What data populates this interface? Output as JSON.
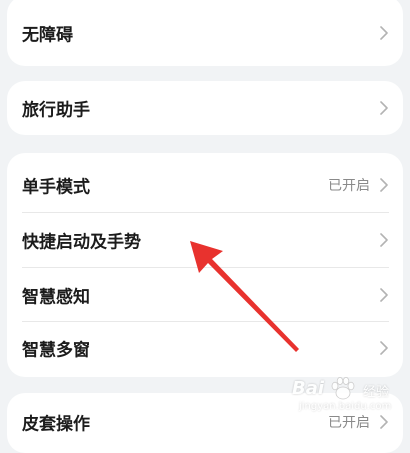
{
  "settings": {
    "group1": {
      "items": [
        {
          "label": "无障碍"
        }
      ]
    },
    "group2": {
      "items": [
        {
          "label": "旅行助手"
        }
      ]
    },
    "group3": {
      "items": [
        {
          "label": "单手模式",
          "value": "已开启"
        },
        {
          "label": "快捷启动及手势"
        },
        {
          "label": "智慧感知"
        },
        {
          "label": "智慧多窗"
        }
      ]
    },
    "group4": {
      "items": [
        {
          "label": "皮套操作",
          "value": "已开启"
        }
      ]
    }
  },
  "colors": {
    "background": "#f1f3f5",
    "card": "#ffffff",
    "label": "#1c1c1c",
    "value": "#8a8a8a",
    "chevron": "#b3b3b3",
    "annotation_arrow": "#e8322e"
  },
  "icons": {
    "row_chevron": "chevron-right-icon"
  },
  "watermark": {
    "logo": "Bai",
    "name": "经验",
    "url": "jingyan.baidu.com"
  }
}
